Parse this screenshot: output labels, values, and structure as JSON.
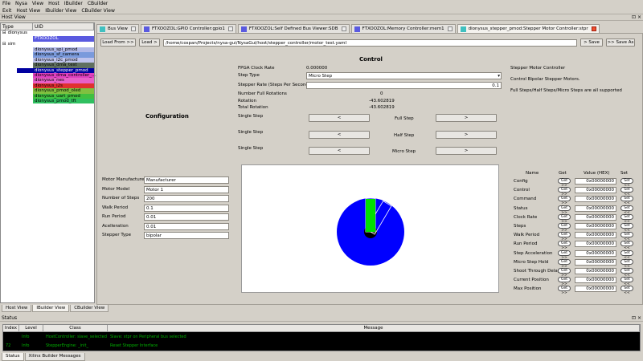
{
  "menu": [
    "File",
    "Nysa",
    "View",
    "Host",
    "IBuilder",
    "CBuilder"
  ],
  "toolbar": [
    "Exit",
    "Host View",
    "IBuilder View",
    "CBuilder View"
  ],
  "host_view_title": "Host View",
  "left": {
    "col_type": "Type",
    "col_uid": "UID",
    "tree": [
      {
        "label": "dionysus",
        "indent": 0,
        "expander": "⊟",
        "color": "#ffffff",
        "text": "#000"
      },
      {
        "label": "",
        "uid": "FTXOOZOL",
        "indent": 0,
        "color": "#5a5ae0",
        "text": "#fff"
      },
      {
        "label": "sim",
        "indent": 0,
        "expander": "⊟",
        "color": "#ffffff",
        "text": "#000"
      }
    ],
    "uids": [
      {
        "label": "dionysus_spi_pmod",
        "color": "#b0b8e8"
      },
      {
        "label": "dionysus_sf_camera",
        "color": "#7a9adc"
      },
      {
        "label": "dionysus_i2c_pmod",
        "color": "#c0c4ec"
      },
      {
        "label": "dionysus_dma_test",
        "color": "#607060"
      },
      {
        "label": "dionysus_stepper_pmod",
        "color": "#0000a0",
        "text": "#fff"
      },
      {
        "label": "dionysus_dma_controller_...",
        "color": "#e040c0"
      },
      {
        "label": "dionysus_nes",
        "color": "#e860c8"
      },
      {
        "label": "dionysus_i2s",
        "color": "#e03030"
      },
      {
        "label": "dionysus_pmod_oled",
        "color": "#80c040"
      },
      {
        "label": "dionysus_uart_pmod",
        "color": "#40c040"
      },
      {
        "label": "dionysus_pmod_tft",
        "color": "#30c060"
      }
    ]
  },
  "tabs": [
    {
      "label": "Bus View",
      "icon": "#40c0c0"
    },
    {
      "label": "FTXOOZOL:GPIO Controller:gpio1",
      "icon": "#5a5ae0"
    },
    {
      "label": "FTXOOZOL:Self Defined Bus Viewer:SDB",
      "icon": "#5a5ae0"
    },
    {
      "label": "FTXOOZOL:Memory Controller:mem1",
      "icon": "#5a5ae0"
    },
    {
      "label": "dionysus_stepper_pmod:Stepper Motor Controller:stpr",
      "icon": "#40c0c0",
      "active": true
    }
  ],
  "file": {
    "load_from": "Load From >>",
    "load": "Load >",
    "path": "/home/cospan/Projects/nysa-gui/NysaGui/host/stepper_controller/motor_test.yaml",
    "save": "> Save",
    "save_as": ">> Save As"
  },
  "control": {
    "title": "Control",
    "fpga_clock_label": "FPGA Clock Rate",
    "fpga_clock_value": "0.000000",
    "step_type_label": "Step Type",
    "step_type_value": "Micro Step",
    "stepper_rate_label": "Stepper Rate (Steps Per Second)",
    "stepper_rate_value": "0.1",
    "full_rot_label": "Number Full Rotations",
    "full_rot_value": "0",
    "rotation_label": "Rotation",
    "rotation_value": "-43.602819",
    "total_rot_label": "Total Rotation",
    "total_rot_value": "-43.602819",
    "single_step": "Single Step",
    "full_step": "Full Step",
    "half_step": "Half Step",
    "micro_step": "Micro Step",
    "left_btn": "<",
    "right_btn": ">"
  },
  "info": {
    "line1": "Stepper Motor Controller",
    "line2": "Control Bipolar Stepper Motors.",
    "line3": "Full Steps/Half Steps/Micro Steps are all supported"
  },
  "configuration": {
    "title": "Configuration",
    "fields": [
      {
        "label": "Motor Manufacturer",
        "value": "Manufacturer"
      },
      {
        "label": "Motor Model",
        "value": "Motor 1"
      },
      {
        "label": "Number of Steps",
        "value": "200"
      },
      {
        "label": "Walk Period",
        "value": "0.1"
      },
      {
        "label": "Run Period",
        "value": "0.01"
      },
      {
        "label": "Acelleration",
        "value": "0.01"
      },
      {
        "label": "Stepper Type",
        "value": "bipolar"
      }
    ]
  },
  "motor": {
    "rotation_deg": -43.602819,
    "disc_color": "#0000ff",
    "shaft_color": "#00e000"
  },
  "registers": {
    "head_name": "Name",
    "head_get": "Get",
    "head_value": "Value (HEX)",
    "head_set": "Set",
    "get_label": "Get >>",
    "set_label": "Set <<",
    "rows": [
      {
        "name": "Config",
        "value": "0x00000000"
      },
      {
        "name": "Control",
        "value": "0x00000000"
      },
      {
        "name": "Command",
        "value": "0x00000000"
      },
      {
        "name": "Status",
        "value": "0x00000000"
      },
      {
        "name": "Clock Rate",
        "value": "0x00000000"
      },
      {
        "name": "Steps",
        "value": "0x00000000"
      },
      {
        "name": "Walk Period",
        "value": "0x00000000"
      },
      {
        "name": "Run Period",
        "value": "0x00000000"
      },
      {
        "name": "Step Acceleration",
        "value": "0x00000000"
      },
      {
        "name": "Micro Step Hold",
        "value": "0x00000000"
      },
      {
        "name": "Shoot Through Delay",
        "value": "0x00000000"
      },
      {
        "name": "Current Position",
        "value": "0x00000000"
      },
      {
        "name": "Max Position",
        "value": "0x00000000"
      }
    ]
  },
  "bottom_tabs": [
    "Host View",
    "IBuilder View",
    "CBuilder View"
  ],
  "status": {
    "title": "Status",
    "head_index": "Index",
    "head_level": "Level",
    "head_class": "Class",
    "head_message": "Message",
    "rows": [
      {
        "index": "",
        "level": "Info",
        "class": "HostController: slave_selected",
        "message": "Slave: stpr on Peripheral bus selected"
      },
      {
        "index": "72",
        "level": "Info",
        "class": "StepperEngine: _init_",
        "message": "Reset Stepper Interface"
      }
    ]
  },
  "status_tabs": [
    "Status",
    "Xilinx Builder Messages"
  ]
}
